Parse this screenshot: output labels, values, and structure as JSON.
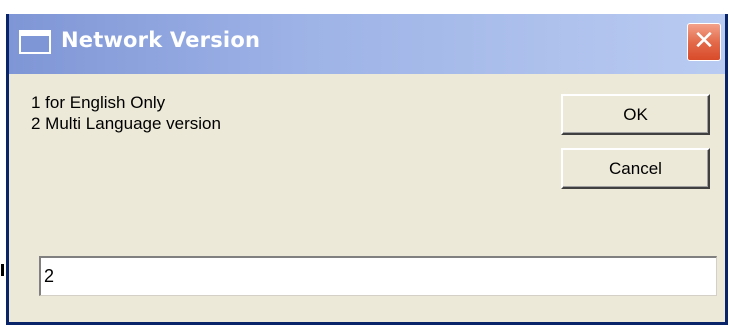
{
  "window": {
    "title": "Network Version",
    "close_symbol": "✕",
    "icon": "window-icon"
  },
  "message": {
    "line1": "1 for English Only",
    "line2": "2 Multi Language version"
  },
  "buttons": {
    "ok_label": "OK",
    "cancel_label": "Cancel"
  },
  "input": {
    "value": "2"
  },
  "colors": {
    "titlebar_start": "#7F96D6",
    "titlebar_end": "#B9CBF1",
    "dialog_background": "#ECE9D8",
    "close_button": "#E36B4B",
    "border": "#0A246A"
  }
}
